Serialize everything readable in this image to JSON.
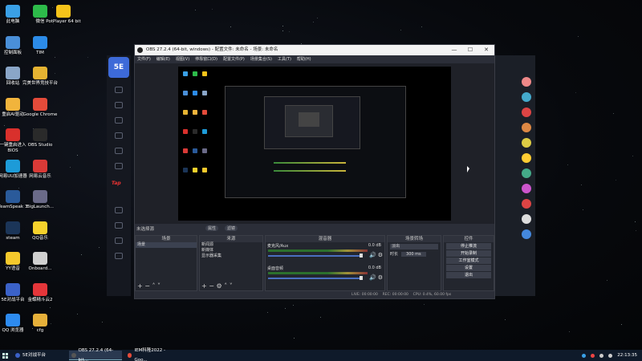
{
  "desktop": {
    "icons": [
      {
        "label": "此电脑",
        "color": "#3aa0e6"
      },
      {
        "label": "微信",
        "color": "#2dbb4a"
      },
      {
        "label": "PotPlayer 64 bit",
        "color": "#f5c31a"
      },
      {
        "label": "控制面板",
        "color": "#4a8fd8"
      },
      {
        "label": "TIM",
        "color": "#2c8be8"
      },
      {
        "label": "回收站",
        "color": "#8aa6c8"
      },
      {
        "label": "完美世界竞技平台",
        "color": "#e5b332"
      },
      {
        "label": "重启AI驱动",
        "color": "#f1b43c"
      },
      {
        "label": "Google Chrome",
        "color": "#e44b3a"
      },
      {
        "label": "一键重启进入BIOS",
        "color": "#d9302c"
      },
      {
        "label": "OBS Studio",
        "color": "#2a2a2a"
      },
      {
        "label": "网易UU加速器",
        "color": "#1d9bd8"
      },
      {
        "label": "网易云音乐",
        "color": "#d93a37"
      },
      {
        "label": "TeamSpeak 3",
        "color": "#2a5a9a"
      },
      {
        "label": "BigLaunch...",
        "color": "#6a6a88"
      },
      {
        "label": "steam",
        "color": "#1b3558"
      },
      {
        "label": "QQ音乐",
        "color": "#f5d12c"
      },
      {
        "label": "YY语音",
        "color": "#f5c92c"
      },
      {
        "label": "Onboard...",
        "color": "#d0d0d0"
      },
      {
        "label": "5E对战平台",
        "color": "#3b62c8"
      },
      {
        "label": "金蝶精斗云2",
        "color": "#e5363a"
      },
      {
        "label": "QQ 浏览器",
        "color": "#2d8bf0"
      },
      {
        "label": "cfg",
        "color": "#e6b03a"
      }
    ]
  },
  "launcher": {
    "logo": "5E",
    "tap": "Tap"
  },
  "obs": {
    "title": "OBS 27.2.4 (64-bit, windows) - 配置文件: 未命名 - 场景: 未命名",
    "window_controls": {
      "minimize": "—",
      "maximize": "☐",
      "close": "✕"
    },
    "menu": [
      "文件(F)",
      "编辑(E)",
      "视图(V)",
      "停靠窗口(D)",
      "配置文件(P)",
      "场景集合(S)",
      "工具(T)",
      "帮助(H)"
    ],
    "source_bar": {
      "no_source": "未选择源",
      "properties": "属性",
      "filters": "滤镜"
    },
    "docks": {
      "scenes": {
        "title": "场景",
        "items": [
          "场景"
        ]
      },
      "sources": {
        "title": "来源",
        "items": [
          "新闻源",
          "新媒体",
          "显示器采集"
        ]
      },
      "mixer": {
        "title": "混音器",
        "channels": [
          {
            "name": "麦克风/Aux",
            "db": "0.0 dB"
          },
          {
            "name": "桌面音频",
            "db": "0.0 dB"
          }
        ]
      },
      "transitions": {
        "title": "场景转场",
        "type": "淡出",
        "duration_label": "时长",
        "duration": "300 ms"
      },
      "controls": {
        "title": "控件",
        "buttons": [
          "停止推流",
          "开始录制",
          "工作室模式",
          "设置",
          "退出"
        ]
      }
    },
    "status": {
      "live": "LIVE: 00:00:00",
      "rec": "REC: 00:00:00",
      "cpu": "CPU: 0.4%, 60.00 fps"
    }
  },
  "taskbar": {
    "items": [
      {
        "label": "5E对战平台",
        "color": "#3b62c8"
      },
      {
        "label": "OBS 27.2.4 (64-bit...",
        "color": "#555"
      },
      {
        "label": "IEM科隆2022 - Goo...",
        "color": "#e44b3a"
      }
    ],
    "time": "22:13:35"
  }
}
